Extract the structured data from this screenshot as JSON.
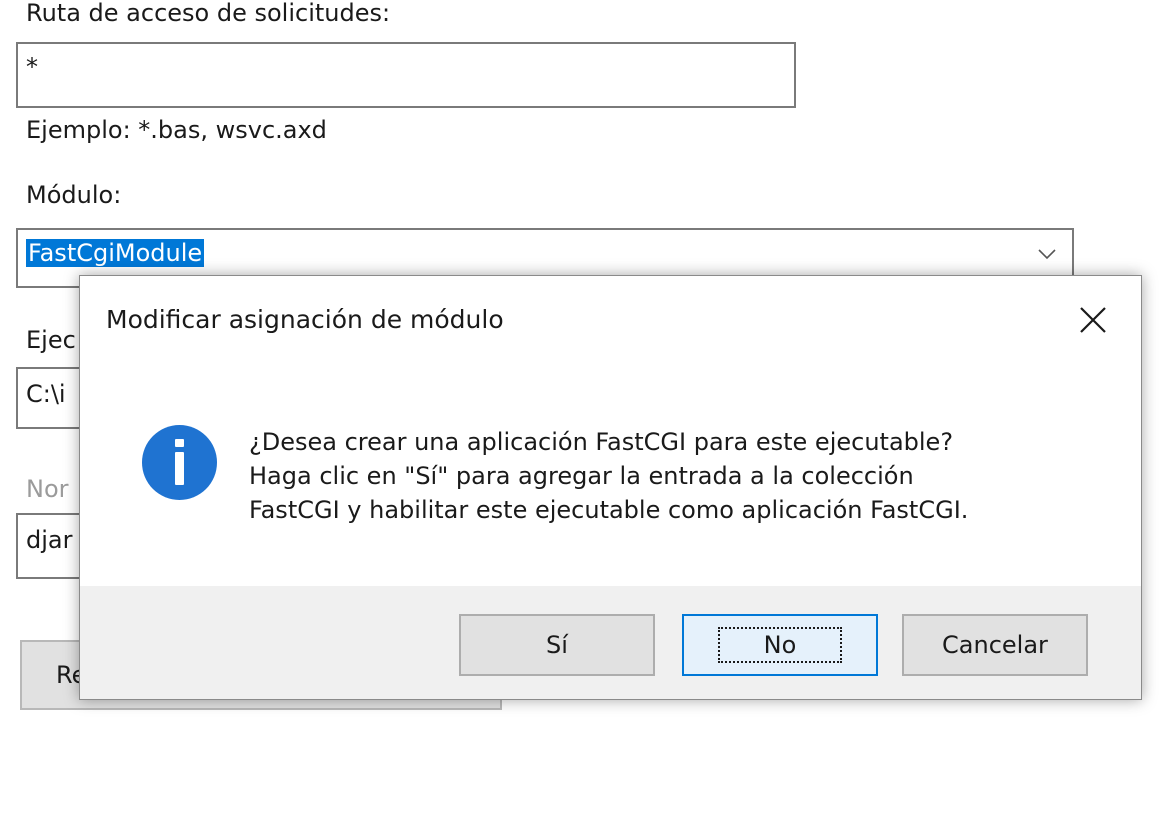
{
  "background_form": {
    "path_label": "Ruta de acceso de solicitudes:",
    "path_value": "*",
    "path_example": "Ejemplo: *.bas, wsvc.axd",
    "module_label": "Módulo:",
    "module_value": "FastCgiModule",
    "executable_label": "Ejec",
    "executable_value": "C:\\i",
    "name_label": "Nor",
    "name_value": "djar",
    "request_button_label": "Re"
  },
  "dialog": {
    "title": "Modificar asignación de módulo",
    "icon": "info-icon",
    "message_lines": [
      "¿Desea crear una aplicación FastCGI para este ejecutable?",
      "Haga clic en \"Sí\" para agregar la entrada a la colección",
      "FastCGI y habilitar este ejecutable como aplicación FastCGI."
    ],
    "buttons": {
      "yes": "Sí",
      "no": "No",
      "cancel": "Cancelar"
    }
  },
  "colors": {
    "selection": "#0078d7",
    "info_icon": "#1f73d1",
    "button_bar": "#f0f0f0",
    "disabled_text": "#9b9b9b"
  }
}
